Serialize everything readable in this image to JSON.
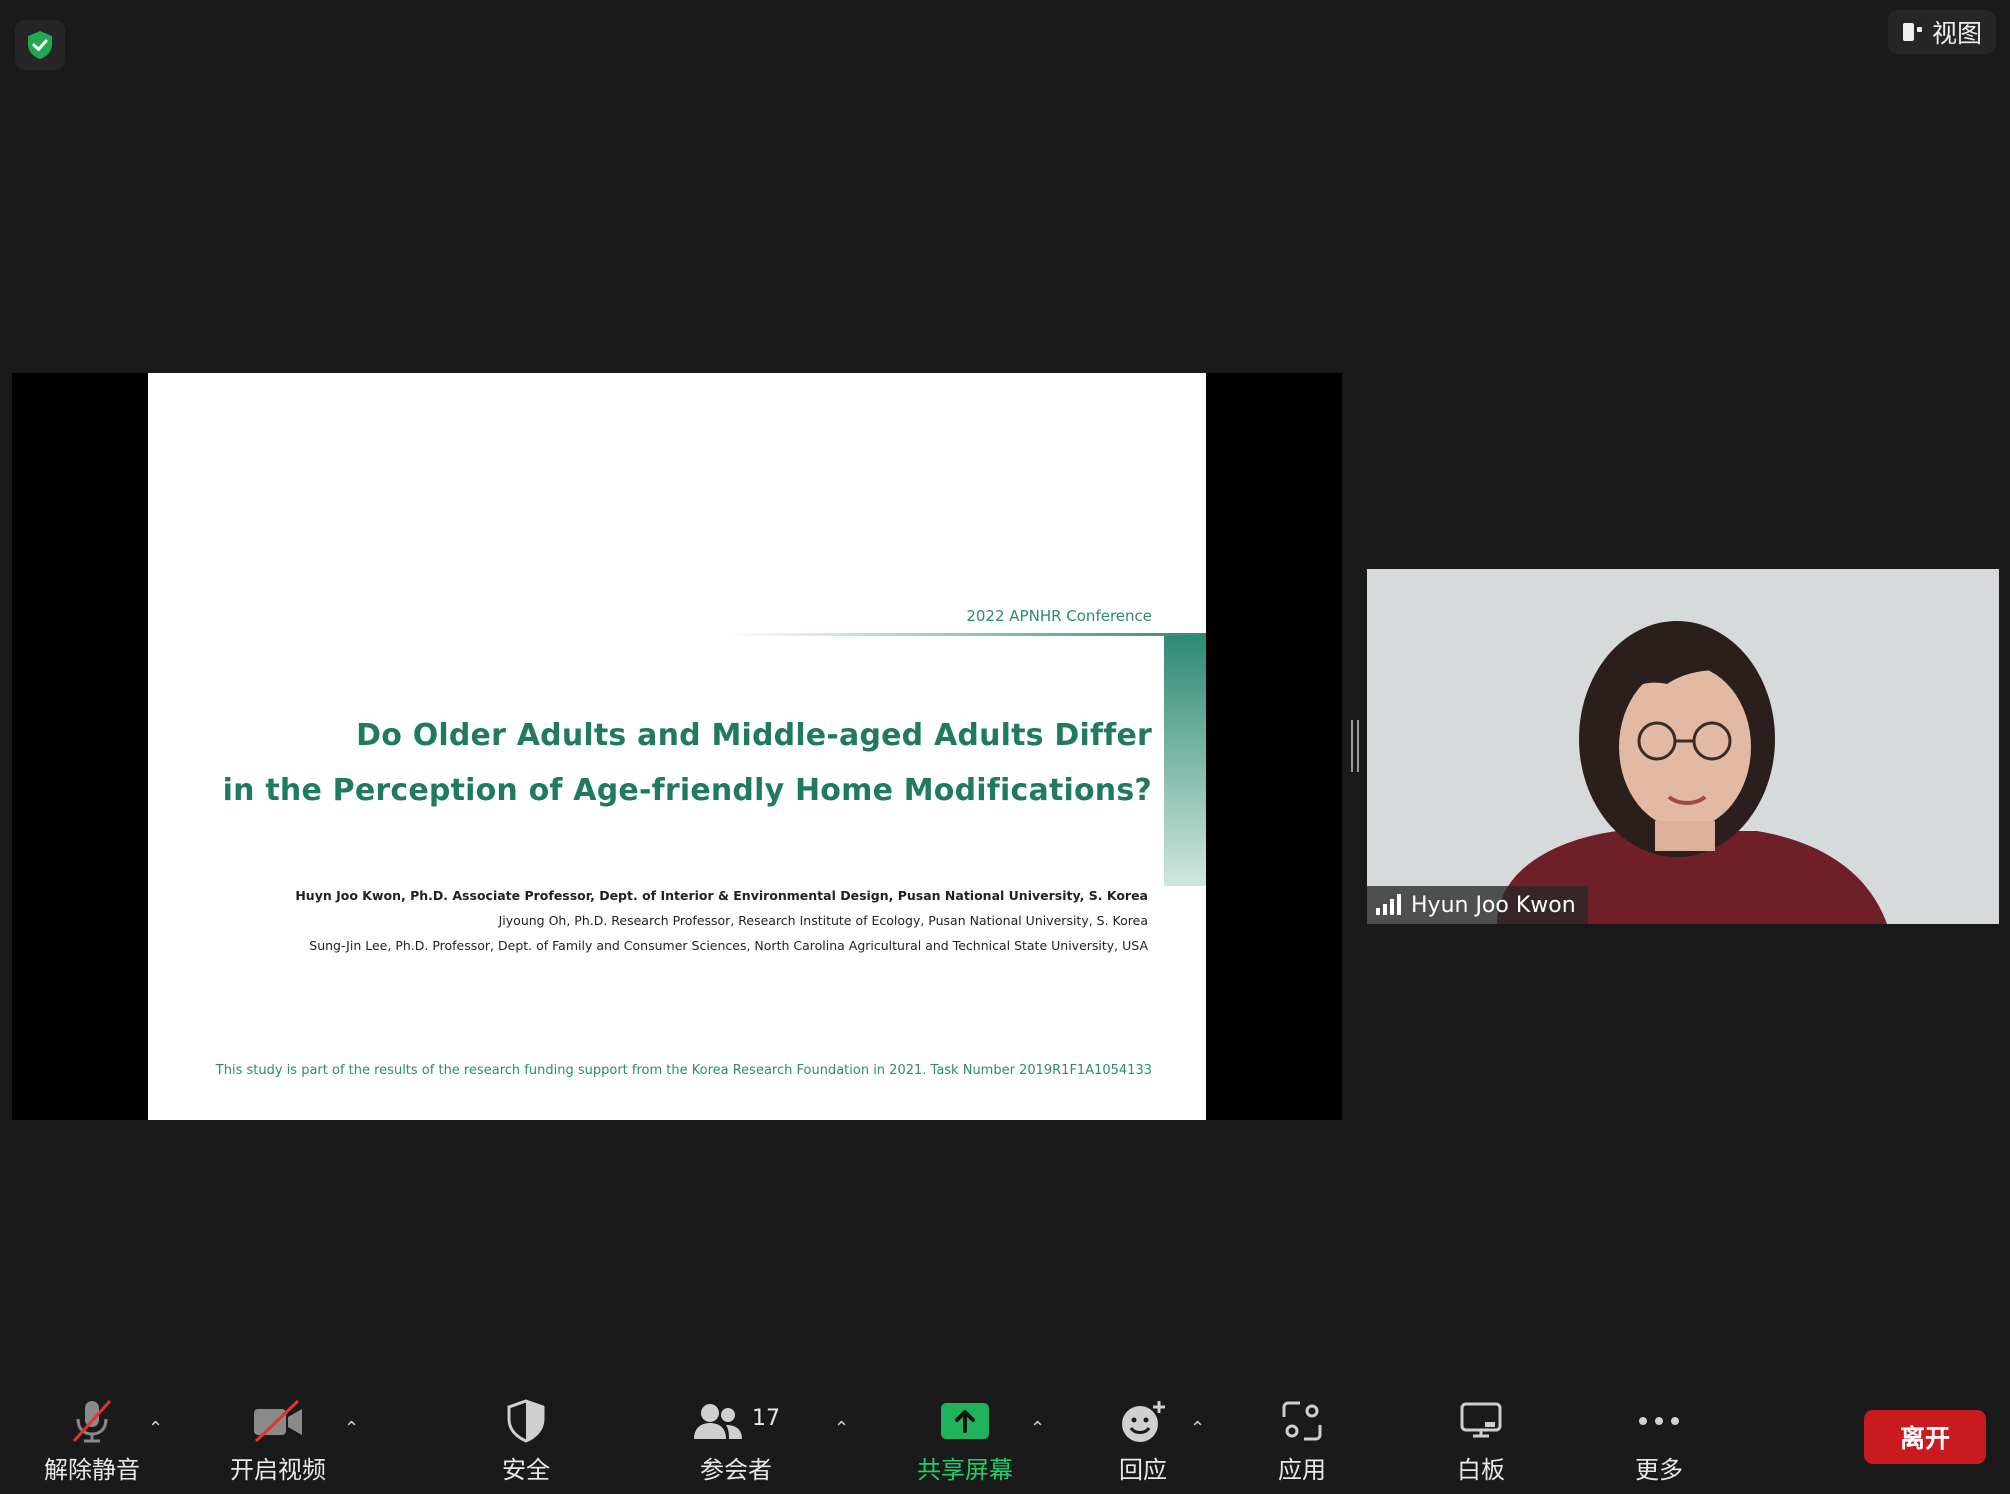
{
  "top": {
    "view_label": "视图",
    "security_icon": "shield-check-icon"
  },
  "slide": {
    "conference": "2022 APNHR Conference",
    "title_line1": "Do Older Adults and Middle-aged Adults Differ",
    "title_line2": "in the Perception of Age-friendly Home Modifications?",
    "author1": "Huyn Joo Kwon, Ph.D. Associate Professor, Dept. of Interior & Environmental Design, Pusan National University, S. Korea",
    "author2": "Jiyoung Oh, Ph.D. Research Professor, Research Institute of Ecology, Pusan National University, S. Korea",
    "author3": "Sung-Jin Lee, Ph.D. Professor, Dept. of Family and Consumer Sciences, North Carolina Agricultural and Technical State University, USA",
    "funding": "This study is part of the results of the research funding support from the Korea Research Foundation in 2021.  Task Number 2019R1F1A1054133"
  },
  "participant": {
    "name": "Hyun Joo Kwon"
  },
  "toolbar": {
    "unmute": "解除静音",
    "start_video": "开启视频",
    "security": "安全",
    "participants": "参会者",
    "participant_count": "17",
    "share_screen": "共享屏幕",
    "reactions": "回应",
    "apps": "应用",
    "whiteboard": "白板",
    "more": "更多",
    "leave": "离开"
  },
  "colors": {
    "accent_green": "#2e8a73",
    "share_green": "#1fb35b",
    "leave_red": "#c81a1f"
  }
}
